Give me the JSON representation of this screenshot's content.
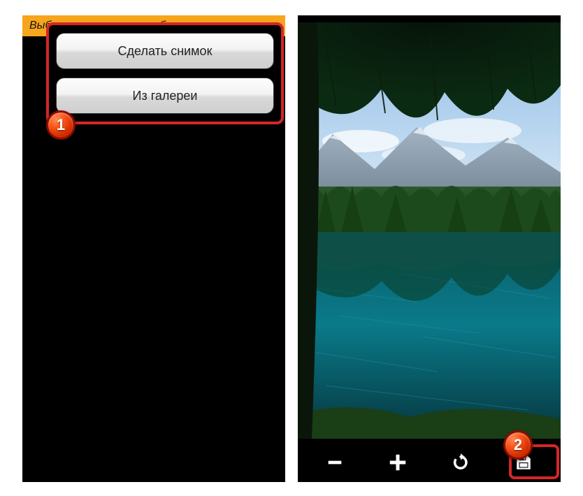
{
  "left": {
    "title": "Выберите источник изображения",
    "buttons": {
      "take_photo": "Сделать снимок",
      "from_gallery": "Из галереи"
    }
  },
  "right": {
    "toolbar": {
      "zoom_out": "minus-icon",
      "zoom_in": "plus-icon",
      "rotate": "rotate-icon",
      "save": "save-icon"
    }
  },
  "annotations": {
    "badge1": "1",
    "badge2": "2"
  }
}
